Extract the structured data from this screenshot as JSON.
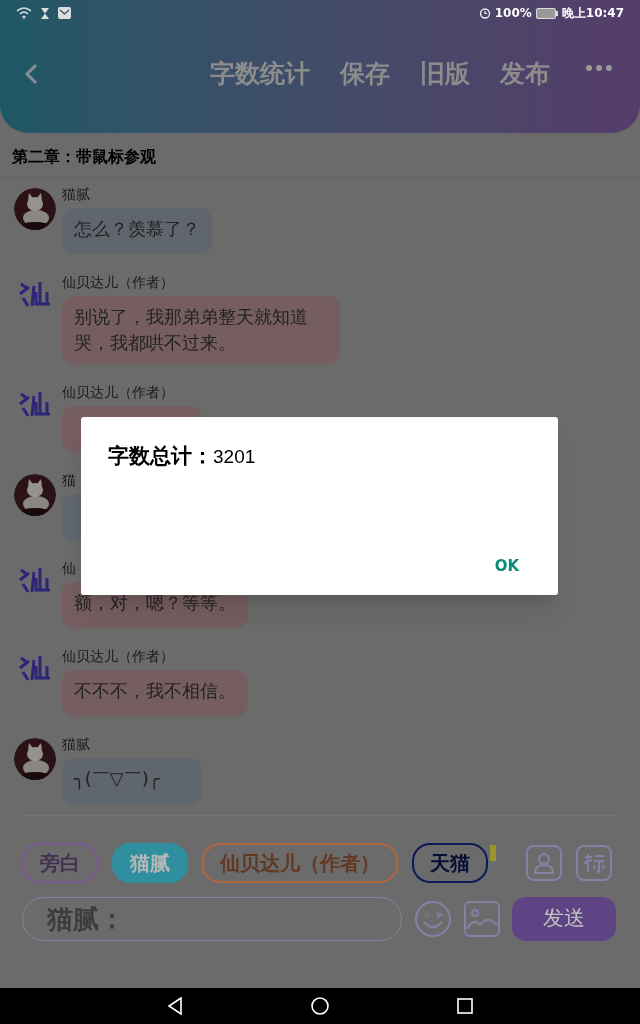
{
  "status_bar": {
    "battery": "100%",
    "time": "晚上10:47"
  },
  "header": {
    "actions": [
      "字数统计",
      "保存",
      "旧版",
      "发布"
    ]
  },
  "chapter_title": "第二章：带鼠标参观",
  "messages": [
    {
      "kind": "cat",
      "name": "猫腻",
      "text": "怎么？羡慕了？"
    },
    {
      "kind": "author",
      "name": "仙贝达儿（作者）",
      "text": "别说了，我那弟弟整天就知道哭，我都哄不过来。"
    },
    {
      "kind": "author",
      "name": "仙贝达儿（作者）"
    },
    {
      "kind": "cat",
      "name": "猫"
    },
    {
      "kind": "author",
      "name": "仙",
      "text": "额，对，嗯？等等。"
    },
    {
      "kind": "author",
      "name": "仙贝达儿（作者）",
      "text": "不不不，我不相信。"
    },
    {
      "kind": "cat",
      "name": "猫腻",
      "text": "╮(￣▽￣)╭"
    }
  ],
  "roles": [
    {
      "label": "旁白",
      "selected": false,
      "color": "#7a5a96"
    },
    {
      "label": "猫腻",
      "selected": true,
      "color": "#2f8f9e"
    },
    {
      "label": "仙贝达儿（作者）",
      "selected": false,
      "color": "#b0663e"
    },
    {
      "label": "天猫",
      "selected": false,
      "color": "#0d1a5a"
    }
  ],
  "input": {
    "placeholder": "猫腻："
  },
  "send_button": "发送",
  "dialog": {
    "title": "字数总计：",
    "count": "3201",
    "button": "OK"
  }
}
